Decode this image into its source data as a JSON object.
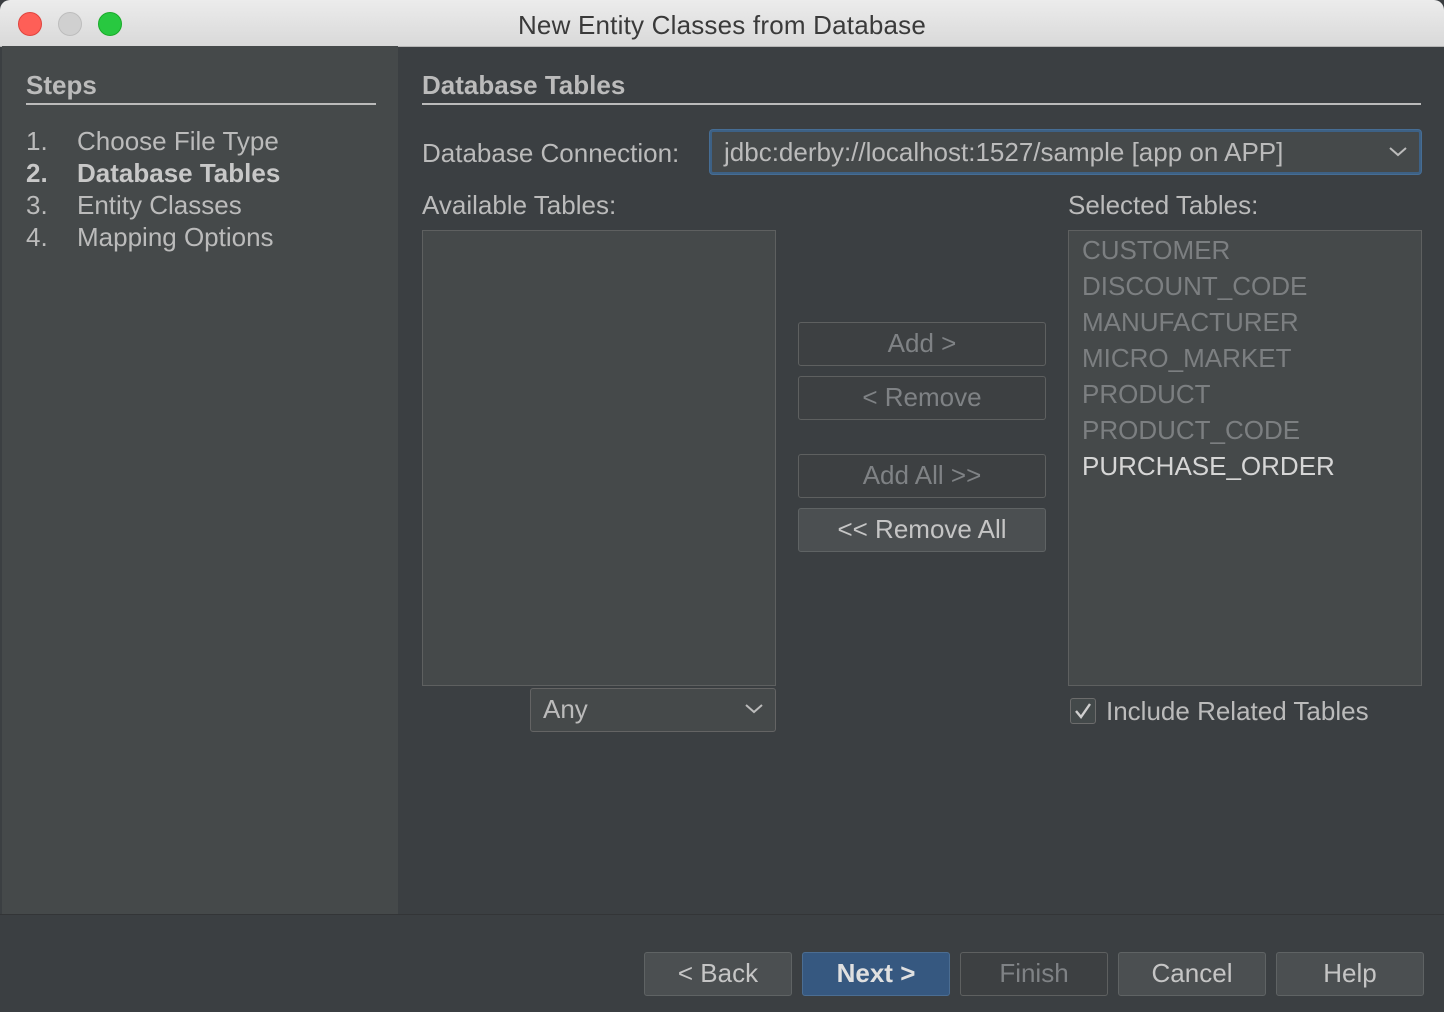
{
  "window": {
    "title": "New Entity Classes from Database"
  },
  "steps": {
    "title": "Steps",
    "items": [
      {
        "num": "1.",
        "label": "Choose File Type"
      },
      {
        "num": "2.",
        "label": "Database Tables"
      },
      {
        "num": "3.",
        "label": "Entity Classes"
      },
      {
        "num": "4.",
        "label": "Mapping Options"
      }
    ]
  },
  "main": {
    "title": "Database Tables",
    "connection_label": "Database Connection:",
    "connection_value": "jdbc:derby://localhost:1527/sample [app on APP]",
    "available_label": "Available Tables:",
    "selected_label": "Selected Tables:",
    "selected_tables": [
      "CUSTOMER",
      "DISCOUNT_CODE",
      "MANUFACTURER",
      "MICRO_MARKET",
      "PRODUCT",
      "PRODUCT_CODE",
      "PURCHASE_ORDER"
    ],
    "filter_value": "Any",
    "buttons": {
      "add": "Add >",
      "remove": "< Remove",
      "add_all": "Add All >>",
      "remove_all": "<< Remove All"
    },
    "include_related": "Include Related Tables"
  },
  "footer": {
    "back": "< Back",
    "next": "Next >",
    "finish": "Finish",
    "cancel": "Cancel",
    "help": "Help"
  },
  "colors": {
    "accent": "#365880",
    "focus_border": "#3d6185",
    "background": "#3b3f42",
    "panel": "#45494a"
  }
}
